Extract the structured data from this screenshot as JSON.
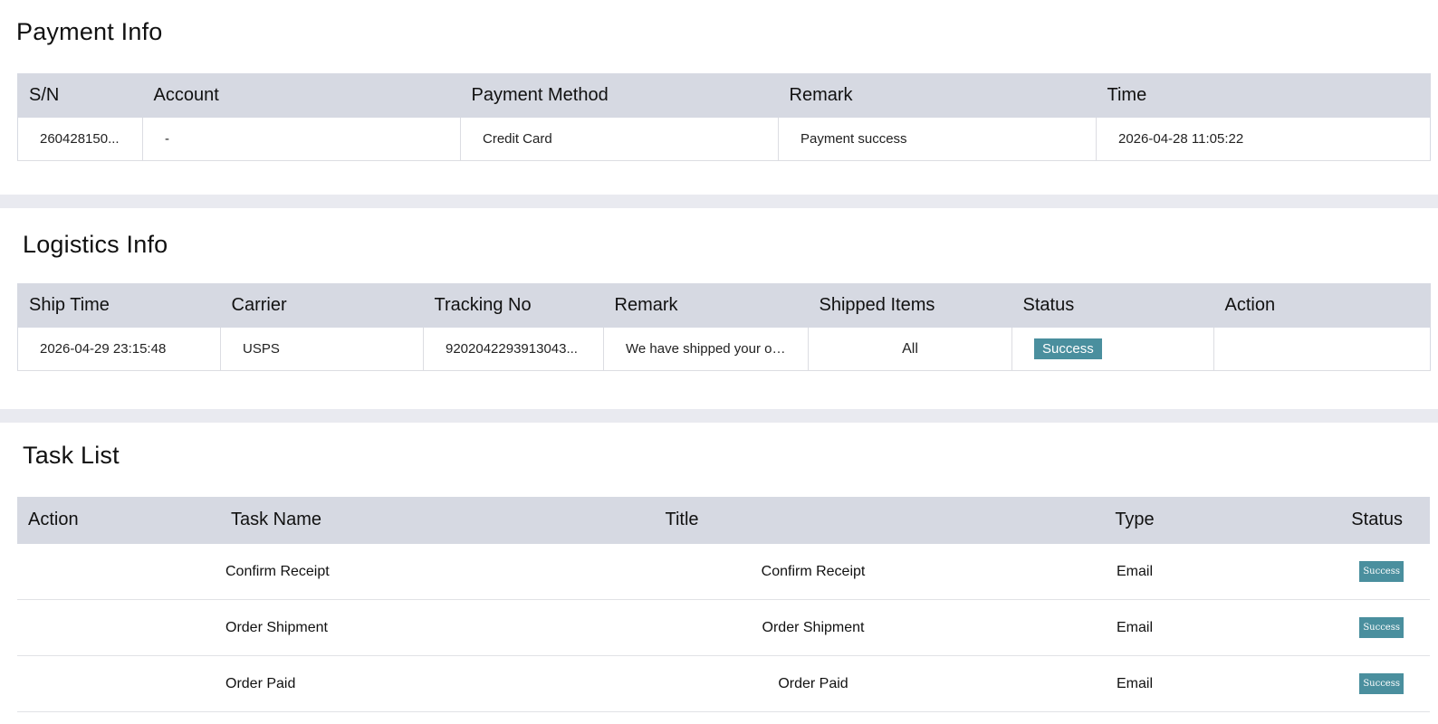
{
  "payment": {
    "title": "Payment Info",
    "headers": [
      "S/N",
      "Account",
      "Payment Method",
      "Remark",
      "Time"
    ],
    "row": {
      "sn": "260428150...",
      "account": "-",
      "method": "Credit Card",
      "remark": "Payment success",
      "time": "2026-04-28 11:05:22"
    }
  },
  "logistics": {
    "title": "Logistics Info",
    "headers": [
      "Ship Time",
      "Carrier",
      "Tracking No",
      "Remark",
      "Shipped Items",
      "Status",
      "Action"
    ],
    "row": {
      "ship_time": "2026-04-29 23:15:48",
      "carrier": "USPS",
      "tracking": "9202042293913043...",
      "remark": "We have shipped your or...",
      "items": "All",
      "status": "Success",
      "action": ""
    }
  },
  "tasks": {
    "title": "Task List",
    "headers": [
      "Action",
      "Task Name",
      "Title",
      "Type",
      "Status"
    ],
    "rows": [
      {
        "action": "",
        "name": "Confirm Receipt",
        "title": "Confirm Receipt",
        "type": "Email",
        "status": "Success"
      },
      {
        "action": "",
        "name": "Order Shipment",
        "title": "Order Shipment",
        "type": "Email",
        "status": "Success"
      },
      {
        "action": "",
        "name": "Order Paid",
        "title": "Order Paid",
        "type": "Email",
        "status": "Success"
      }
    ]
  },
  "colors": {
    "header_bg": "#d6d9e2",
    "band_bg": "#e9eaf0",
    "success_badge": "#4a8f9e"
  }
}
